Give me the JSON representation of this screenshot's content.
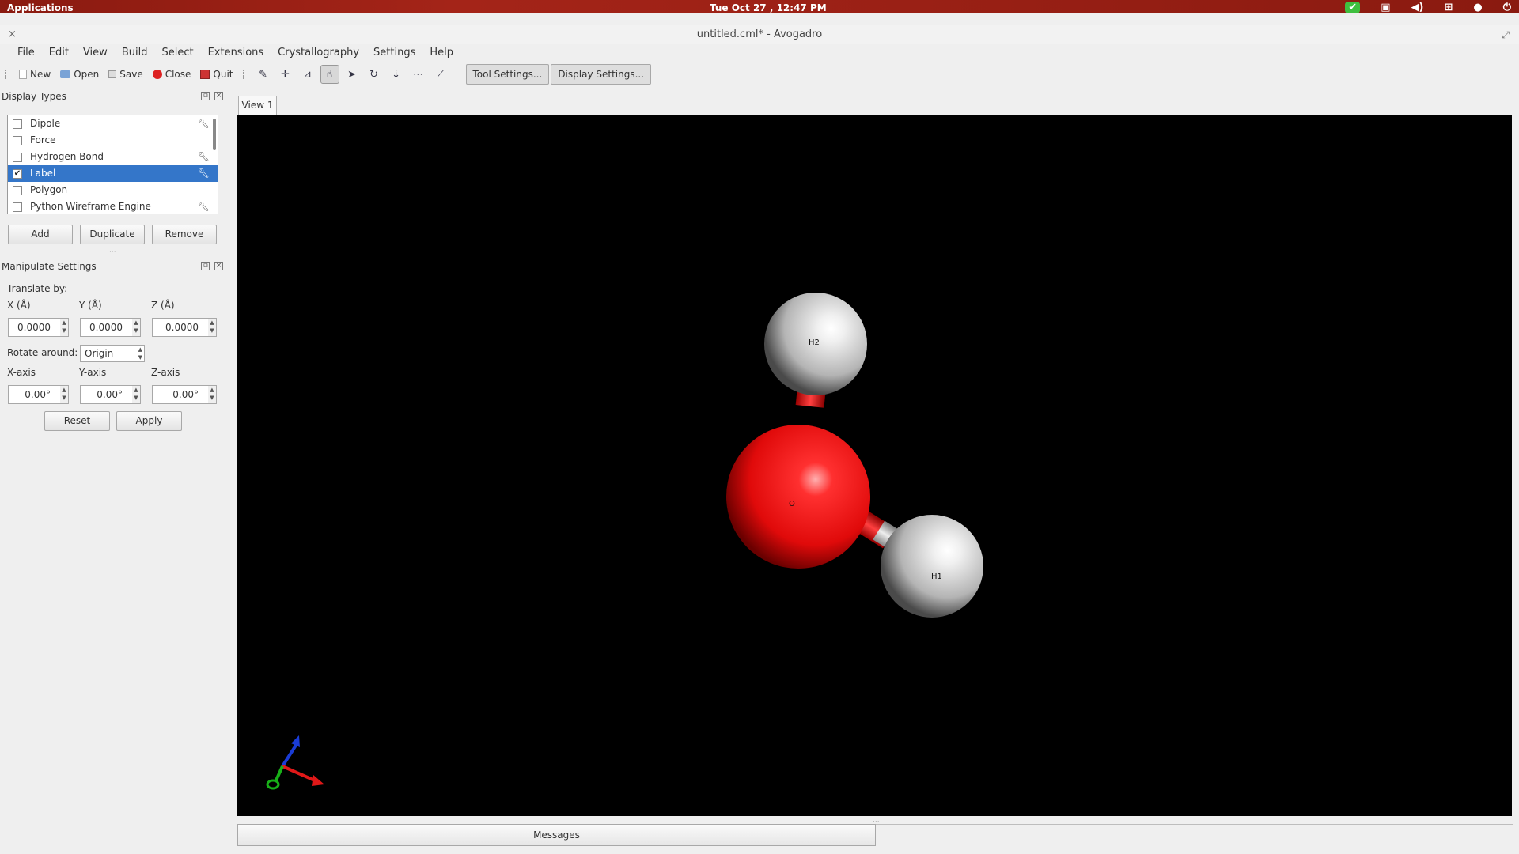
{
  "top_panel": {
    "applications": "Applications",
    "clock": "Tue Oct 27 , 12:47 PM"
  },
  "window": {
    "title": "untitled.cml* - Avogadro"
  },
  "menu": [
    "File",
    "Edit",
    "View",
    "Build",
    "Select",
    "Extensions",
    "Crystallography",
    "Settings",
    "Help"
  ],
  "toolbar": {
    "new": "New",
    "open": "Open",
    "save": "Save",
    "close": "Close",
    "quit": "Quit",
    "tool_settings": "Tool Settings...",
    "display_settings": "Display Settings..."
  },
  "display_types": {
    "title": "Display Types",
    "items": [
      {
        "label": "Dipole",
        "checked": false,
        "selected": false,
        "settings": true
      },
      {
        "label": "Force",
        "checked": false,
        "selected": false,
        "settings": false
      },
      {
        "label": "Hydrogen Bond",
        "checked": false,
        "selected": false,
        "settings": true
      },
      {
        "label": "Label",
        "checked": true,
        "selected": true,
        "settings": true
      },
      {
        "label": "Polygon",
        "checked": false,
        "selected": false,
        "settings": false
      },
      {
        "label": "Python Wireframe Engine",
        "checked": false,
        "selected": false,
        "settings": true
      }
    ],
    "add": "Add",
    "duplicate": "Duplicate",
    "remove": "Remove"
  },
  "manipulate": {
    "title": "Manipulate Settings",
    "translate_by": "Translate by:",
    "x_label": "X (Å)",
    "y_label": "Y (Å)",
    "z_label": "Z (Å)",
    "x_value": "0.0000",
    "y_value": "0.0000",
    "z_value": "0.0000",
    "rotate_around": "Rotate around:",
    "rotate_value": "Origin",
    "xaxis_label": "X-axis",
    "yaxis_label": "Y-axis",
    "zaxis_label": "Z-axis",
    "xaxis_value": "0.00°",
    "yaxis_value": "0.00°",
    "zaxis_value": "0.00°",
    "reset": "Reset",
    "apply": "Apply"
  },
  "view": {
    "tab": "View 1",
    "atoms": {
      "oxygen": "O",
      "h1": "H1",
      "h2": "H2"
    },
    "colors": {
      "oxygen": "#e41010",
      "hydrogen": "#d8d8d8",
      "background": "#000000"
    }
  },
  "messages": "Messages"
}
